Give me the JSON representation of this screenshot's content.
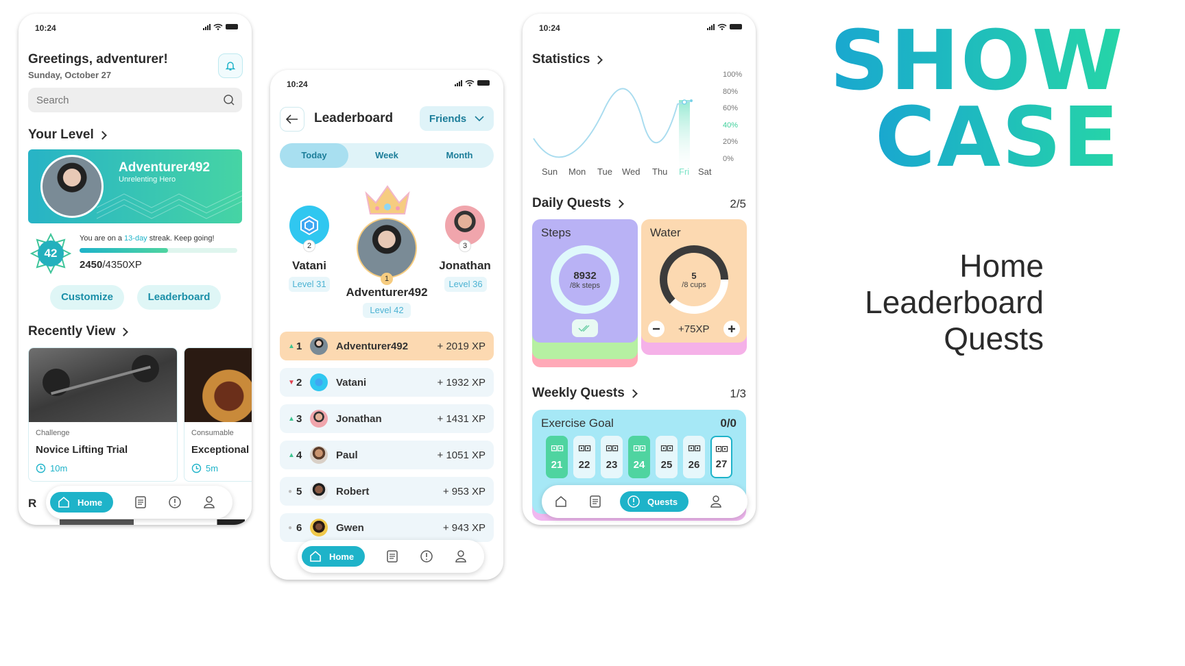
{
  "home": {
    "status_time": "10:24",
    "greeting": "Greetings, adventurer!",
    "date": "Sunday, October 27",
    "search_placeholder": "Search",
    "your_level_title": "Your Level",
    "username": "Adventurer492",
    "user_title": "Unrelenting Hero",
    "level": "42",
    "streak_prefix": "You are on a ",
    "streak_days": "13-day",
    "streak_suffix": " streak. Keep going!",
    "xp_current": "2450",
    "xp_total": "/4350XP",
    "xp_progress": 0.56,
    "customize_label": "Customize",
    "leaderboard_label": "Leaderboard",
    "recently_view_title": "Recently View",
    "cards": [
      {
        "category": "Challenge",
        "title": "Novice Lifting Trial",
        "duration": "10m"
      },
      {
        "category": "Consumable",
        "title": "Exceptional",
        "duration": "5m"
      }
    ],
    "partial_heading": "R",
    "nav_home": "Home"
  },
  "leaderboard": {
    "status_time": "10:24",
    "title": "Leaderboard",
    "filter": "Friends",
    "tabs": [
      "Today",
      "Week",
      "Month"
    ],
    "active_tab": "Today",
    "podium": [
      {
        "name": "Vatani",
        "level": "Level 31",
        "rank": "2"
      },
      {
        "name": "Adventurer492",
        "level": "Level 42",
        "rank": "1"
      },
      {
        "name": "Jonathan",
        "level": "Level 36",
        "rank": "3"
      }
    ],
    "rows": [
      {
        "rank": "1",
        "name": "Adventurer492",
        "xp": "+ 2019 XP",
        "trend": "up"
      },
      {
        "rank": "2",
        "name": "Vatani",
        "xp": "+ 1932 XP",
        "trend": "down"
      },
      {
        "rank": "3",
        "name": "Jonathan",
        "xp": "+ 1431 XP",
        "trend": "up"
      },
      {
        "rank": "4",
        "name": "Paul",
        "xp": "+ 1051 XP",
        "trend": "up"
      },
      {
        "rank": "5",
        "name": "Robert",
        "xp": "+ 953 XP",
        "trend": "same"
      },
      {
        "rank": "6",
        "name": "Gwen",
        "xp": "+ 943 XP",
        "trend": "same"
      }
    ],
    "nav_home": "Home"
  },
  "quests": {
    "status_time": "10:24",
    "statistics_title": "Statistics",
    "y_ticks": [
      "100%",
      "80%",
      "60%",
      "40%",
      "20%",
      "0%"
    ],
    "days": [
      "Sun",
      "Mon",
      "Tue",
      "Wed",
      "Thu",
      "Fri",
      "Sat"
    ],
    "highlight_day": "Fri",
    "daily_title": "Daily Quests",
    "daily_count": "2/5",
    "steps_label": "Steps",
    "steps_value": "8932",
    "steps_unit": "/8k steps",
    "water_label": "Water",
    "water_value": "5",
    "water_unit": "/8 cups",
    "water_progress": 0.625,
    "water_xp": "+75XP",
    "weekly_title": "Weekly Quests",
    "weekly_count": "1/3",
    "exercise_label": "Exercise Goal",
    "exercise_count": "0/0",
    "exercise_days": [
      "21",
      "22",
      "23",
      "24",
      "25",
      "26",
      "27"
    ],
    "nav_quests": "Quests"
  },
  "showcase": {
    "title_line1": "SHOW",
    "title_line2": "CASE",
    "items": [
      "Home",
      "Leaderboard",
      "Quests"
    ]
  },
  "colors": {
    "teal": "#1eb3c9",
    "green": "#4fd4a0",
    "steps_purple": "#b9b2f5",
    "water_orange": "#fcd9b1"
  }
}
